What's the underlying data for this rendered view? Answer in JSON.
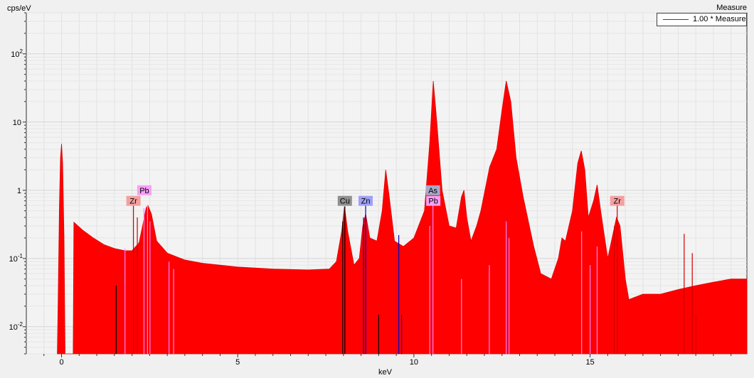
{
  "chart_data": {
    "type": "area",
    "title": "Measure",
    "xlabel": "keV",
    "ylabel": "cps/eV",
    "xlim": [
      -1.0,
      19.45
    ],
    "ylim": [
      0.004,
      400
    ],
    "yscale": "log",
    "grid": true,
    "legend_position": "top-right",
    "x_ticks": [
      0,
      5,
      10,
      15
    ],
    "y_ticks": [
      {
        "value": 0.01,
        "base": "10",
        "exp": "-2"
      },
      {
        "value": 0.1,
        "base": "10",
        "exp": "-1"
      },
      {
        "value": 1,
        "base": "1",
        "exp": ""
      },
      {
        "value": 10,
        "base": "10",
        "exp": ""
      },
      {
        "value": 100,
        "base": "10",
        "exp": "2"
      }
    ],
    "series": [
      {
        "name": "1.00 * Measure",
        "color": "#ff0000",
        "points": [
          [
            -0.12,
            0.004
          ],
          [
            -0.1,
            0.018
          ],
          [
            -0.06,
            0.6
          ],
          [
            -0.03,
            3.0
          ],
          [
            0.0,
            4.8
          ],
          [
            0.03,
            2.5
          ],
          [
            0.07,
            0.2
          ],
          [
            0.1,
            0.004
          ],
          [
            0.33,
            0.004
          ],
          [
            0.35,
            0.34
          ],
          [
            0.6,
            0.26
          ],
          [
            0.9,
            0.2
          ],
          [
            1.2,
            0.16
          ],
          [
            1.5,
            0.14
          ],
          [
            1.8,
            0.13
          ],
          [
            2.0,
            0.13
          ],
          [
            2.2,
            0.17
          ],
          [
            2.3,
            0.3
          ],
          [
            2.4,
            0.55
          ],
          [
            2.45,
            0.6
          ],
          [
            2.55,
            0.45
          ],
          [
            2.7,
            0.18
          ],
          [
            3.0,
            0.12
          ],
          [
            3.5,
            0.095
          ],
          [
            4.0,
            0.085
          ],
          [
            5.0,
            0.075
          ],
          [
            6.0,
            0.07
          ],
          [
            7.0,
            0.068
          ],
          [
            7.6,
            0.07
          ],
          [
            7.8,
            0.09
          ],
          [
            7.95,
            0.25
          ],
          [
            8.03,
            0.58
          ],
          [
            8.12,
            0.25
          ],
          [
            8.3,
            0.08
          ],
          [
            8.45,
            0.1
          ],
          [
            8.55,
            0.3
          ],
          [
            8.63,
            0.45
          ],
          [
            8.75,
            0.2
          ],
          [
            8.95,
            0.18
          ],
          [
            9.1,
            0.5
          ],
          [
            9.2,
            2.0
          ],
          [
            9.3,
            0.8
          ],
          [
            9.45,
            0.18
          ],
          [
            9.7,
            0.15
          ],
          [
            10.0,
            0.2
          ],
          [
            10.3,
            0.5
          ],
          [
            10.45,
            5.0
          ],
          [
            10.55,
            40
          ],
          [
            10.65,
            10
          ],
          [
            10.8,
            1.0
          ],
          [
            11.0,
            0.3
          ],
          [
            11.2,
            0.28
          ],
          [
            11.35,
            0.8
          ],
          [
            11.42,
            1.0
          ],
          [
            11.5,
            0.4
          ],
          [
            11.62,
            0.18
          ],
          [
            11.78,
            0.3
          ],
          [
            11.9,
            0.5
          ],
          [
            12.15,
            2.2
          ],
          [
            12.35,
            4.0
          ],
          [
            12.5,
            15
          ],
          [
            12.62,
            40
          ],
          [
            12.75,
            20
          ],
          [
            12.9,
            3.0
          ],
          [
            13.1,
            0.8
          ],
          [
            13.4,
            0.15
          ],
          [
            13.6,
            0.06
          ],
          [
            13.9,
            0.05
          ],
          [
            14.1,
            0.1
          ],
          [
            14.2,
            0.2
          ],
          [
            14.3,
            0.18
          ],
          [
            14.5,
            0.5
          ],
          [
            14.65,
            2.5
          ],
          [
            14.75,
            3.8
          ],
          [
            14.85,
            2.0
          ],
          [
            14.95,
            0.4
          ],
          [
            15.1,
            0.7
          ],
          [
            15.2,
            1.2
          ],
          [
            15.3,
            0.5
          ],
          [
            15.5,
            0.1
          ],
          [
            15.75,
            0.4
          ],
          [
            15.85,
            0.3
          ],
          [
            16.0,
            0.05
          ],
          [
            16.1,
            0.025
          ],
          [
            16.5,
            0.03
          ],
          [
            17.0,
            0.03
          ],
          [
            17.5,
            0.035
          ],
          [
            18.0,
            0.04
          ],
          [
            18.5,
            0.045
          ],
          [
            19.0,
            0.05
          ],
          [
            19.45,
            0.05
          ]
        ]
      }
    ],
    "element_markers": [
      {
        "element": "Zr",
        "x": 2.04,
        "label_y": 0.7,
        "color": "#f4a0a0"
      },
      {
        "element": "Pb",
        "x": 2.35,
        "label_y": 1.0,
        "color": "#f6a0f6"
      },
      {
        "element": "Cu",
        "x": 8.04,
        "label_y": 0.7,
        "color": "#909090"
      },
      {
        "element": "Zn",
        "x": 8.63,
        "label_y": 0.7,
        "color": "#a0a0f6"
      },
      {
        "element": "As",
        "x": 10.54,
        "label_y": 1.0,
        "color": "#a8a8c8"
      },
      {
        "element": "Pb",
        "x": 10.55,
        "label_y": 0.7,
        "color": "#f6a0f6"
      },
      {
        "element": "Zr",
        "x": 15.77,
        "label_y": 0.7,
        "color": "#f4a0a0"
      }
    ],
    "marker_lines": [
      {
        "x": 2.04,
        "y": 0.6,
        "color": "#d00000"
      },
      {
        "x": 2.15,
        "y": 0.4,
        "color": "#d00000"
      },
      {
        "x": 1.8,
        "y": 0.14,
        "color": "#ff80ff"
      },
      {
        "x": 2.34,
        "y": 0.55,
        "color": "#ff80ff"
      },
      {
        "x": 2.44,
        "y": 0.6,
        "color": "#ff80ff"
      },
      {
        "x": 2.51,
        "y": 0.35,
        "color": "#ff80ff"
      },
      {
        "x": 3.05,
        "y": 0.09,
        "color": "#ff80ff"
      },
      {
        "x": 3.18,
        "y": 0.07,
        "color": "#ff80ff"
      },
      {
        "x": 1.55,
        "y": 0.04,
        "color": "#000000"
      },
      {
        "x": 8.04,
        "y": 0.58,
        "color": "#000000"
      },
      {
        "x": 7.98,
        "y": 0.35,
        "color": "#000000"
      },
      {
        "x": 8.63,
        "y": 0.6,
        "color": "#0000c0"
      },
      {
        "x": 8.57,
        "y": 0.4,
        "color": "#0000c0"
      },
      {
        "x": 9.57,
        "y": 0.22,
        "color": "#0000c0"
      },
      {
        "x": 9.65,
        "y": 0.015,
        "color": "#0000c0"
      },
      {
        "x": 9.0,
        "y": 0.015,
        "color": "#000000"
      },
      {
        "x": 10.54,
        "y": 0.6,
        "color": "#ff80ff"
      },
      {
        "x": 10.45,
        "y": 0.3,
        "color": "#ff80ff"
      },
      {
        "x": 11.35,
        "y": 0.05,
        "color": "#ff80ff"
      },
      {
        "x": 12.62,
        "y": 0.35,
        "color": "#ff80ff"
      },
      {
        "x": 12.14,
        "y": 0.08,
        "color": "#ff80ff"
      },
      {
        "x": 12.7,
        "y": 0.2,
        "color": "#ff80ff"
      },
      {
        "x": 14.76,
        "y": 0.25,
        "color": "#ff80ff"
      },
      {
        "x": 15.0,
        "y": 0.08,
        "color": "#ff80ff"
      },
      {
        "x": 15.2,
        "y": 0.15,
        "color": "#ff80ff"
      },
      {
        "x": 15.77,
        "y": 0.6,
        "color": "#d00000"
      },
      {
        "x": 15.69,
        "y": 0.3,
        "color": "#d00000"
      },
      {
        "x": 17.67,
        "y": 0.23,
        "color": "#d00000"
      },
      {
        "x": 17.9,
        "y": 0.12,
        "color": "#d00000"
      },
      {
        "x": 18.0,
        "y": 0.015,
        "color": "#d00000"
      }
    ]
  }
}
